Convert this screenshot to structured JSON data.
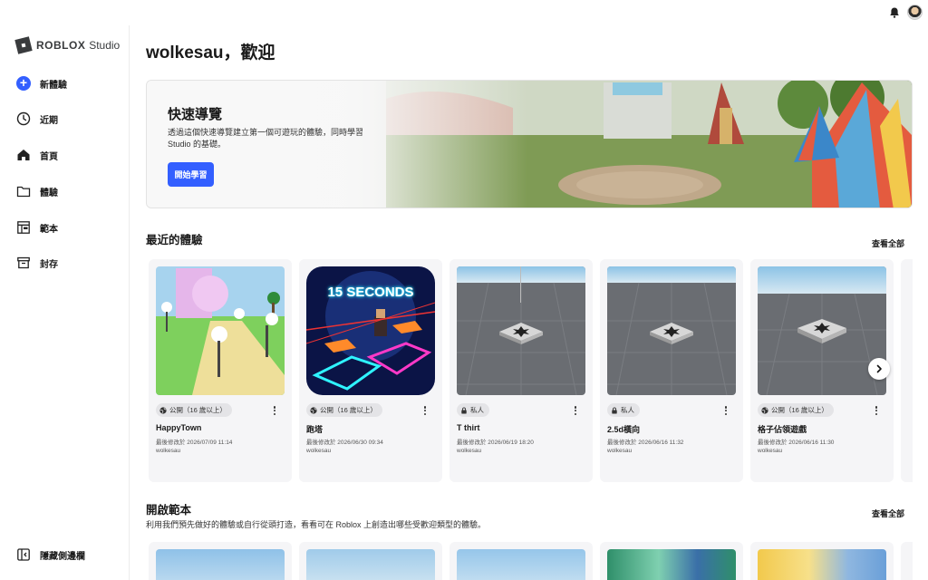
{
  "app": {
    "logo": "ROBLOX",
    "logo_suffix": "Studio"
  },
  "sidebar": {
    "items": [
      {
        "label": "新體驗",
        "icon": "plus-circle-icon"
      },
      {
        "label": "近期",
        "icon": "clock-icon"
      },
      {
        "label": "首頁",
        "icon": "home-icon"
      },
      {
        "label": "體驗",
        "icon": "folder-icon"
      },
      {
        "label": "範本",
        "icon": "template-icon"
      },
      {
        "label": "封存",
        "icon": "archive-icon"
      }
    ],
    "hide_label": "隱藏側邊欄"
  },
  "header": {
    "welcome": "wolkesau，歡迎"
  },
  "banner": {
    "title": "快速導覽",
    "description": "透過這個快速導覽建立第一個可遊玩的體驗，同時學習 Studio 的基礎。",
    "button": "開始學習"
  },
  "recent": {
    "title": "最近的體驗",
    "view_all": "查看全部",
    "cards": [
      {
        "title": "HappyTown",
        "visibility": "公開（16 歲以上）",
        "visibility_icon": "globe-icon",
        "modified": "最後修改於 2026/07/09 11:14",
        "owner": "wolkesau"
      },
      {
        "title": "跑塔",
        "visibility": "公開（16 歲以上）",
        "visibility_icon": "globe-icon",
        "modified": "最後修改於 2026/06/30 09:34",
        "owner": "wolkesau",
        "thumb_text": "15 SECONDS"
      },
      {
        "title": "T thirt",
        "visibility": "私人",
        "visibility_icon": "lock-icon",
        "modified": "最後修改於 2026/06/19 18:20",
        "owner": "wolkesau"
      },
      {
        "title": "2.5d橫向",
        "visibility": "私人",
        "visibility_icon": "lock-icon",
        "modified": "最後修改於 2026/06/16 11:32",
        "owner": "wolkesau"
      },
      {
        "title": "格子佔領遊戲",
        "visibility": "公開（16 歲以上）",
        "visibility_icon": "globe-icon",
        "modified": "最後修改於 2026/06/16 11:30",
        "owner": "wolkesau"
      }
    ]
  },
  "templates": {
    "title": "開啟範本",
    "subtitle": "利用我們預先做好的體驗或自行從頭打造，看看可在 Roblox 上創造出哪些受歡迎類型的體驗。",
    "view_all": "查看全部"
  },
  "colors": {
    "accent": "#335fff",
    "card_bg": "#f5f5f7"
  }
}
